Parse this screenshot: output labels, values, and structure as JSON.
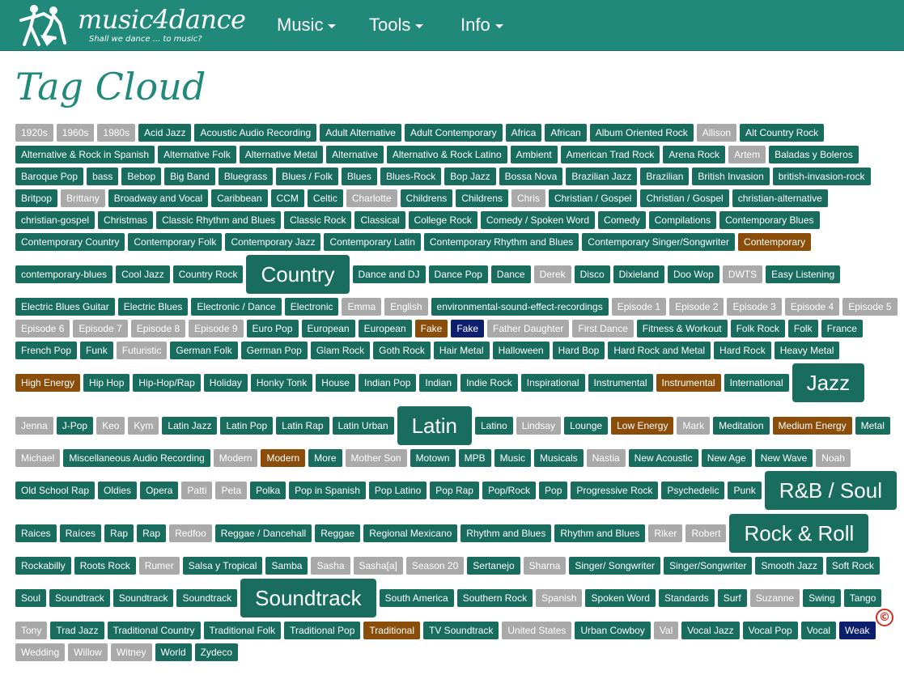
{
  "brand": {
    "name": "music4dance",
    "tagline": "Shall we dance ... to music?"
  },
  "nav": {
    "items": [
      "Music",
      "Tools",
      "Info"
    ]
  },
  "page": {
    "title": "Tag Cloud"
  },
  "colors": {
    "navbar": "#20897a",
    "teal": "#186d5f",
    "gray": "#a9a9a9",
    "orange": "#8a4e0a",
    "navy": "#0c1f6e",
    "title": "#20897a"
  },
  "tags": [
    {
      "t": "1920s",
      "c": "gray"
    },
    {
      "t": "1960s",
      "c": "gray"
    },
    {
      "t": "1980s",
      "c": "gray"
    },
    {
      "t": "Acid Jazz",
      "c": "teal"
    },
    {
      "t": "Acoustic Audio Recording",
      "c": "teal"
    },
    {
      "t": "Adult Alternative",
      "c": "teal"
    },
    {
      "t": "Adult Contemporary",
      "c": "teal"
    },
    {
      "t": "Africa",
      "c": "teal"
    },
    {
      "t": "African",
      "c": "teal"
    },
    {
      "t": "Album Oriented Rock",
      "c": "teal"
    },
    {
      "t": "Allison",
      "c": "gray"
    },
    {
      "t": "Alt Country Rock",
      "c": "teal"
    },
    {
      "t": "Alternative & Rock in Spanish",
      "c": "teal"
    },
    {
      "t": "Alternative Folk",
      "c": "teal"
    },
    {
      "t": "Alternative Metal",
      "c": "teal"
    },
    {
      "t": "Alternative",
      "c": "teal"
    },
    {
      "t": "Alternativo & Rock Latino",
      "c": "teal"
    },
    {
      "t": "Ambient",
      "c": "teal"
    },
    {
      "t": "American Trad Rock",
      "c": "teal"
    },
    {
      "t": "Arena Rock",
      "c": "teal"
    },
    {
      "t": "Artem",
      "c": "gray"
    },
    {
      "t": "Baladas y Boleros",
      "c": "teal"
    },
    {
      "t": "Baroque Pop",
      "c": "teal"
    },
    {
      "t": "bass",
      "c": "teal"
    },
    {
      "t": "Bebop",
      "c": "teal"
    },
    {
      "t": "Big Band",
      "c": "teal"
    },
    {
      "t": "Bluegrass",
      "c": "teal"
    },
    {
      "t": "Blues / Folk",
      "c": "teal"
    },
    {
      "t": "Blues",
      "c": "teal"
    },
    {
      "t": "Blues-Rock",
      "c": "teal"
    },
    {
      "t": "Bop Jazz",
      "c": "teal"
    },
    {
      "t": "Bossa Nova",
      "c": "teal"
    },
    {
      "t": "Brazilian Jazz",
      "c": "teal"
    },
    {
      "t": "Brazilian",
      "c": "teal"
    },
    {
      "t": "British Invasion",
      "c": "teal"
    },
    {
      "t": "british-invasion-rock",
      "c": "teal"
    },
    {
      "t": "Britpop",
      "c": "teal"
    },
    {
      "t": "Brittany",
      "c": "gray"
    },
    {
      "t": "Broadway and Vocal",
      "c": "teal"
    },
    {
      "t": "Caribbean",
      "c": "teal"
    },
    {
      "t": "CCM",
      "c": "teal"
    },
    {
      "t": "Celtic",
      "c": "teal"
    },
    {
      "t": "Charlotte",
      "c": "gray"
    },
    {
      "t": "Childrens",
      "c": "teal"
    },
    {
      "t": "Childrens",
      "c": "teal"
    },
    {
      "t": "Chris",
      "c": "gray"
    },
    {
      "t": "Christian / Gospel",
      "c": "teal"
    },
    {
      "t": "Christian / Gospel",
      "c": "teal"
    },
    {
      "t": "christian-alternative",
      "c": "teal"
    },
    {
      "t": "christian-gospel",
      "c": "teal"
    },
    {
      "t": "Christmas",
      "c": "teal"
    },
    {
      "t": "Classic Rhythm and Blues",
      "c": "teal"
    },
    {
      "t": "Classic Rock",
      "c": "teal"
    },
    {
      "t": "Classical",
      "c": "teal"
    },
    {
      "t": "College Rock",
      "c": "teal"
    },
    {
      "t": "Comedy / Spoken Word",
      "c": "teal"
    },
    {
      "t": "Comedy",
      "c": "teal"
    },
    {
      "t": "Compilations",
      "c": "teal"
    },
    {
      "t": "Contemporary Blues",
      "c": "teal"
    },
    {
      "t": "Contemporary Country",
      "c": "teal"
    },
    {
      "t": "Contemporary Folk",
      "c": "teal"
    },
    {
      "t": "Contemporary Jazz",
      "c": "teal"
    },
    {
      "t": "Contemporary Latin",
      "c": "teal"
    },
    {
      "t": "Contemporary Rhythm and Blues",
      "c": "teal"
    },
    {
      "t": "Contemporary Singer/Songwriter",
      "c": "teal"
    },
    {
      "t": "Contemporary",
      "c": "orange"
    },
    {
      "t": "contemporary-blues",
      "c": "teal"
    },
    {
      "t": "Cool Jazz",
      "c": "teal"
    },
    {
      "t": "Country Rock",
      "c": "teal"
    },
    {
      "t": "Country",
      "c": "teal",
      "s": "big"
    },
    {
      "t": "Dance and DJ",
      "c": "teal"
    },
    {
      "t": "Dance Pop",
      "c": "teal"
    },
    {
      "t": "Dance",
      "c": "teal"
    },
    {
      "t": "Derek",
      "c": "gray"
    },
    {
      "t": "Disco",
      "c": "teal"
    },
    {
      "t": "Dixieland",
      "c": "teal"
    },
    {
      "t": "Doo Wop",
      "c": "teal"
    },
    {
      "t": "DWTS",
      "c": "gray"
    },
    {
      "t": "Easy Listening",
      "c": "teal"
    },
    {
      "t": "Electric Blues Guitar",
      "c": "teal"
    },
    {
      "t": "Electric Blues",
      "c": "teal"
    },
    {
      "t": "Electronic / Dance",
      "c": "teal"
    },
    {
      "t": "Electronic",
      "c": "teal"
    },
    {
      "t": "Emma",
      "c": "gray"
    },
    {
      "t": "English",
      "c": "gray"
    },
    {
      "t": "environmental-sound-effect-recordings",
      "c": "teal"
    },
    {
      "t": "Episode 1",
      "c": "gray"
    },
    {
      "t": "Episode 2",
      "c": "gray"
    },
    {
      "t": "Episode 3",
      "c": "gray"
    },
    {
      "t": "Episode 4",
      "c": "gray"
    },
    {
      "t": "Episode 5",
      "c": "gray"
    },
    {
      "t": "Episode 6",
      "c": "gray"
    },
    {
      "t": "Episode 7",
      "c": "gray"
    },
    {
      "t": "Episode 8",
      "c": "gray"
    },
    {
      "t": "Episode 9",
      "c": "gray"
    },
    {
      "t": "Euro Pop",
      "c": "teal"
    },
    {
      "t": "European",
      "c": "teal"
    },
    {
      "t": "European",
      "c": "teal"
    },
    {
      "t": "Fake",
      "c": "orange"
    },
    {
      "t": "Fake",
      "c": "navy"
    },
    {
      "t": "Father Daughter",
      "c": "gray"
    },
    {
      "t": "First Dance",
      "c": "gray"
    },
    {
      "t": "Fitness & Workout",
      "c": "teal"
    },
    {
      "t": "Folk Rock",
      "c": "teal"
    },
    {
      "t": "Folk",
      "c": "teal"
    },
    {
      "t": "France",
      "c": "teal"
    },
    {
      "t": "French Pop",
      "c": "teal"
    },
    {
      "t": "Funk",
      "c": "teal"
    },
    {
      "t": "Futuristic",
      "c": "gray"
    },
    {
      "t": "German Folk",
      "c": "teal"
    },
    {
      "t": "German Pop",
      "c": "teal"
    },
    {
      "t": "Glam Rock",
      "c": "teal"
    },
    {
      "t": "Goth Rock",
      "c": "teal"
    },
    {
      "t": "Hair Metal",
      "c": "teal"
    },
    {
      "t": "Halloween",
      "c": "teal"
    },
    {
      "t": "Hard Bop",
      "c": "teal"
    },
    {
      "t": "Hard Rock and Metal",
      "c": "teal"
    },
    {
      "t": "Hard Rock",
      "c": "teal"
    },
    {
      "t": "Heavy Metal",
      "c": "teal"
    },
    {
      "t": "High Energy",
      "c": "orange"
    },
    {
      "t": "Hip Hop",
      "c": "teal"
    },
    {
      "t": "Hip-Hop/Rap",
      "c": "teal"
    },
    {
      "t": "Holiday",
      "c": "teal"
    },
    {
      "t": "Honky Tonk",
      "c": "teal"
    },
    {
      "t": "House",
      "c": "teal"
    },
    {
      "t": "Indian Pop",
      "c": "teal"
    },
    {
      "t": "Indian",
      "c": "teal"
    },
    {
      "t": "Indie Rock",
      "c": "teal"
    },
    {
      "t": "Inspirational",
      "c": "teal"
    },
    {
      "t": "Instrumental",
      "c": "teal"
    },
    {
      "t": "Instrumental",
      "c": "orange"
    },
    {
      "t": "International",
      "c": "teal"
    },
    {
      "t": "Jazz",
      "c": "teal",
      "s": "big"
    },
    {
      "t": "Jenna",
      "c": "gray"
    },
    {
      "t": "J-Pop",
      "c": "teal"
    },
    {
      "t": "Keo",
      "c": "gray"
    },
    {
      "t": "Kym",
      "c": "gray"
    },
    {
      "t": "Latin Jazz",
      "c": "teal"
    },
    {
      "t": "Latin Pop",
      "c": "teal"
    },
    {
      "t": "Latin Rap",
      "c": "teal"
    },
    {
      "t": "Latin Urban",
      "c": "teal"
    },
    {
      "t": "Latin",
      "c": "teal",
      "s": "big"
    },
    {
      "t": "Latino",
      "c": "teal"
    },
    {
      "t": "Lindsay",
      "c": "gray"
    },
    {
      "t": "Lounge",
      "c": "teal"
    },
    {
      "t": "Low Energy",
      "c": "orange"
    },
    {
      "t": "Mark",
      "c": "gray"
    },
    {
      "t": "Meditation",
      "c": "teal"
    },
    {
      "t": "Medium Energy",
      "c": "orange"
    },
    {
      "t": "Metal",
      "c": "teal"
    },
    {
      "t": "Michael",
      "c": "gray"
    },
    {
      "t": "Miscellaneous Audio Recording",
      "c": "teal"
    },
    {
      "t": "Modern",
      "c": "gray"
    },
    {
      "t": "Modern",
      "c": "orange"
    },
    {
      "t": "More",
      "c": "teal"
    },
    {
      "t": "Mother Son",
      "c": "gray"
    },
    {
      "t": "Motown",
      "c": "teal"
    },
    {
      "t": "MPB",
      "c": "teal"
    },
    {
      "t": "Music",
      "c": "teal"
    },
    {
      "t": "Musicals",
      "c": "teal"
    },
    {
      "t": "Nastia",
      "c": "gray"
    },
    {
      "t": "New Acoustic",
      "c": "teal"
    },
    {
      "t": "New Age",
      "c": "teal"
    },
    {
      "t": "New Wave",
      "c": "teal"
    },
    {
      "t": "Noah",
      "c": "gray"
    },
    {
      "t": "Old School Rap",
      "c": "teal"
    },
    {
      "t": "Oldies",
      "c": "teal"
    },
    {
      "t": "Opera",
      "c": "teal"
    },
    {
      "t": "Patti",
      "c": "gray"
    },
    {
      "t": "Peta",
      "c": "gray"
    },
    {
      "t": "Polka",
      "c": "teal"
    },
    {
      "t": "Pop in Spanish",
      "c": "teal"
    },
    {
      "t": "Pop Latino",
      "c": "teal"
    },
    {
      "t": "Pop Rap",
      "c": "teal"
    },
    {
      "t": "Pop/Rock",
      "c": "teal"
    },
    {
      "t": "Pop",
      "c": "teal"
    },
    {
      "t": "Progressive Rock",
      "c": "teal"
    },
    {
      "t": "Psychedelic",
      "c": "teal"
    },
    {
      "t": "Punk",
      "c": "teal"
    },
    {
      "t": "R&B / Soul",
      "c": "teal",
      "s": "big"
    },
    {
      "t": "Raices",
      "c": "teal"
    },
    {
      "t": "Raíces",
      "c": "teal"
    },
    {
      "t": "Rap",
      "c": "teal"
    },
    {
      "t": "Rap",
      "c": "teal"
    },
    {
      "t": "Redfoo",
      "c": "gray"
    },
    {
      "t": "Reggae / Dancehall",
      "c": "teal"
    },
    {
      "t": "Reggae",
      "c": "teal"
    },
    {
      "t": "Regional Mexicano",
      "c": "teal"
    },
    {
      "t": "Rhythm and Blues",
      "c": "teal"
    },
    {
      "t": "Rhythm and Blues",
      "c": "teal"
    },
    {
      "t": "Riker",
      "c": "gray"
    },
    {
      "t": "Robert",
      "c": "gray"
    },
    {
      "t": "Rock & Roll",
      "c": "teal",
      "s": "big"
    },
    {
      "t": "Rockabilly",
      "c": "teal"
    },
    {
      "t": "Roots Rock",
      "c": "teal"
    },
    {
      "t": "Rumer",
      "c": "gray"
    },
    {
      "t": "Salsa y Tropical",
      "c": "teal"
    },
    {
      "t": "Samba",
      "c": "teal"
    },
    {
      "t": "Sasha",
      "c": "gray"
    },
    {
      "t": "Sasha[a]",
      "c": "gray"
    },
    {
      "t": "Season 20",
      "c": "gray"
    },
    {
      "t": "Sertanejo",
      "c": "teal"
    },
    {
      "t": "Sharna",
      "c": "gray"
    },
    {
      "t": "Singer/ Songwriter",
      "c": "teal"
    },
    {
      "t": "Singer/Songwriter",
      "c": "teal"
    },
    {
      "t": "Smooth Jazz",
      "c": "teal"
    },
    {
      "t": "Soft Rock",
      "c": "teal"
    },
    {
      "t": "Soul",
      "c": "teal"
    },
    {
      "t": "Soundtrack",
      "c": "teal"
    },
    {
      "t": "Soundtrack",
      "c": "teal"
    },
    {
      "t": "Soundtrack",
      "c": "teal"
    },
    {
      "t": "Soundtrack",
      "c": "teal",
      "s": "big"
    },
    {
      "t": "South America",
      "c": "teal"
    },
    {
      "t": "Southern Rock",
      "c": "teal"
    },
    {
      "t": "Spanish",
      "c": "gray"
    },
    {
      "t": "Spoken Word",
      "c": "teal"
    },
    {
      "t": "Standards",
      "c": "teal"
    },
    {
      "t": "Surf",
      "c": "teal"
    },
    {
      "t": "Suzanne",
      "c": "gray"
    },
    {
      "t": "Swing",
      "c": "teal"
    },
    {
      "t": "Tango",
      "c": "teal"
    },
    {
      "t": "Tony",
      "c": "gray"
    },
    {
      "t": "Trad Jazz",
      "c": "teal"
    },
    {
      "t": "Traditional Country",
      "c": "teal"
    },
    {
      "t": "Traditional Folk",
      "c": "teal"
    },
    {
      "t": "Traditional Pop",
      "c": "teal"
    },
    {
      "t": "Traditional",
      "c": "orange"
    },
    {
      "t": "TV Soundtrack",
      "c": "teal"
    },
    {
      "t": "United States",
      "c": "gray"
    },
    {
      "t": "Urban Cowboy",
      "c": "teal"
    },
    {
      "t": "Val",
      "c": "gray"
    },
    {
      "t": "Vocal Jazz",
      "c": "teal"
    },
    {
      "t": "Vocal Pop",
      "c": "teal"
    },
    {
      "t": "Vocal",
      "c": "teal"
    },
    {
      "t": "Weak",
      "c": "navy"
    },
    {
      "t": "Wedding",
      "c": "gray"
    },
    {
      "t": "Willow",
      "c": "gray"
    },
    {
      "t": "Witney",
      "c": "gray"
    },
    {
      "t": "World",
      "c": "teal"
    },
    {
      "t": "Zydeco",
      "c": "teal"
    }
  ],
  "copyright_symbol": "©"
}
